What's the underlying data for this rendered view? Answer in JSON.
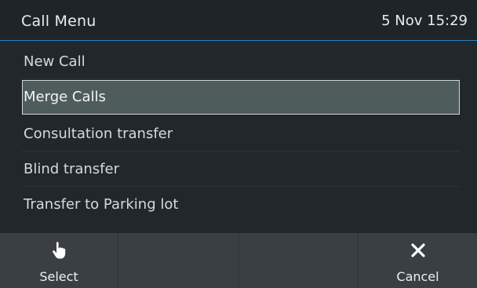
{
  "header": {
    "title": "Call Menu",
    "clock": "5 Nov 15:29"
  },
  "menu": {
    "items": [
      {
        "label": "New Call"
      },
      {
        "label": "Merge Calls",
        "selected": true
      },
      {
        "label": "Consultation transfer"
      },
      {
        "label": "Blind transfer"
      },
      {
        "label": "Transfer to Parking lot"
      }
    ]
  },
  "softkeys": [
    {
      "label": "Select",
      "icon": "hand-pointer-icon"
    },
    {
      "label": ""
    },
    {
      "label": ""
    },
    {
      "label": "Cancel",
      "icon": "close-icon"
    }
  ],
  "colors": {
    "accent": "#2f7fbf",
    "selected_bg": "#4e5c5b"
  }
}
